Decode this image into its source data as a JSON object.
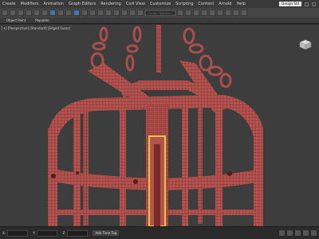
{
  "menu": {
    "items": [
      "Create",
      "Modifiers",
      "Animation",
      "Graph Editors",
      "Rendering",
      "Civil View",
      "Customize",
      "Scripting",
      "Content",
      "Arnold",
      "Help"
    ],
    "workspace": "Design Std"
  },
  "toolbar": {
    "selection_set_placeholder": "Create Selection Set"
  },
  "ribbon": {
    "tabs": [
      "Object Paint",
      "Populate"
    ]
  },
  "viewport": {
    "label": "[+] [Perspective] [Standard] [Edged Faces]"
  },
  "status": {
    "x_label": "X:",
    "y_label": "Y:",
    "z_label": "Z:",
    "x_value": "",
    "y_value": "",
    "z_value": "",
    "add_time_tag": "Add Time Tag"
  },
  "colors": {
    "mesh_fill": "#b35450",
    "mesh_wire": "#6a1e1c",
    "highlight": "#e8c83a"
  }
}
